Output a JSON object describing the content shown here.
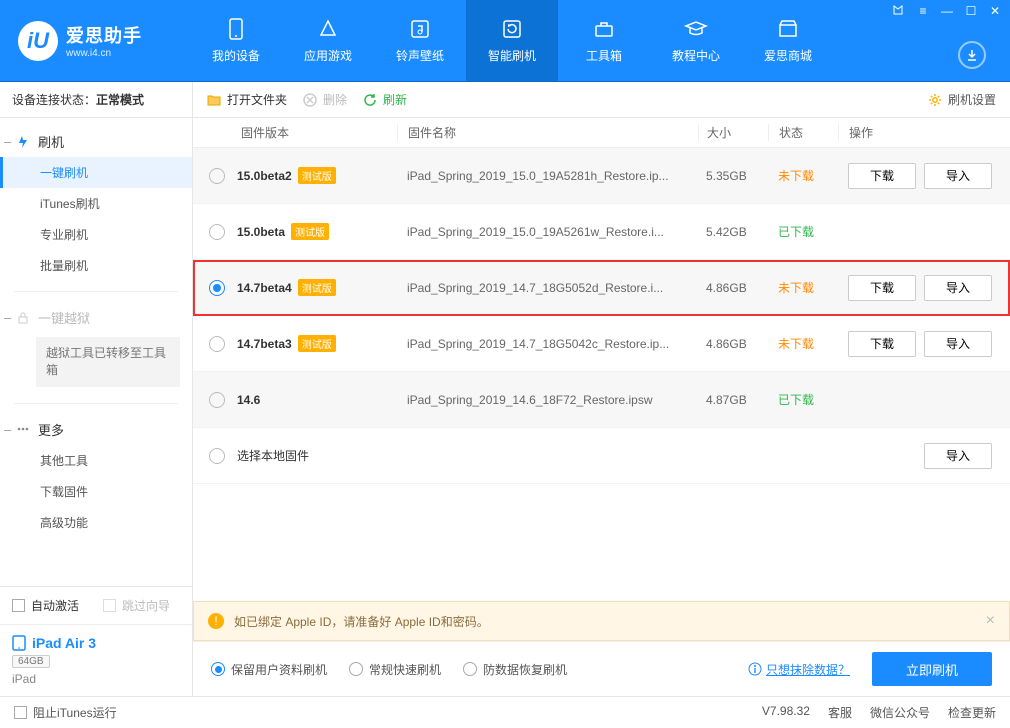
{
  "app": {
    "name_cn": "爱思助手",
    "url": "www.i4.cn"
  },
  "window_controls": {
    "shirt": "▾",
    "menu": "≡",
    "min": "—",
    "max": "☐",
    "close": "✕"
  },
  "nav": [
    {
      "label": "我的设备"
    },
    {
      "label": "应用游戏"
    },
    {
      "label": "铃声壁纸"
    },
    {
      "label": "智能刷机"
    },
    {
      "label": "工具箱"
    },
    {
      "label": "教程中心"
    },
    {
      "label": "爱思商城"
    }
  ],
  "sidebar": {
    "conn_label": "设备连接状态：",
    "conn_value": "正常模式",
    "groups": {
      "flash": {
        "title": "刷机",
        "items": [
          "一键刷机",
          "iTunes刷机",
          "专业刷机",
          "批量刷机"
        ]
      },
      "jailbreak": {
        "title": "一键越狱",
        "note": "越狱工具已转移至工具箱"
      },
      "more": {
        "title": "更多",
        "items": [
          "其他工具",
          "下载固件",
          "高级功能"
        ]
      }
    },
    "auto_activate": "自动激活",
    "skip_guide": "跳过向导",
    "device": {
      "name": "iPad Air 3",
      "storage": "64GB",
      "type": "iPad"
    }
  },
  "toolbar": {
    "open": "打开文件夹",
    "delete": "删除",
    "refresh": "刷新",
    "settings": "刷机设置"
  },
  "table": {
    "headers": {
      "version": "固件版本",
      "name": "固件名称",
      "size": "大小",
      "status": "状态",
      "ops": "操作"
    },
    "beta_tag": "测试版",
    "btn_download": "下载",
    "btn_import": "导入",
    "local_label": "选择本地固件",
    "rows": [
      {
        "version": "15.0beta2",
        "beta": true,
        "name": "iPad_Spring_2019_15.0_19A5281h_Restore.ip...",
        "size": "5.35GB",
        "status": "未下载",
        "downloaded": false,
        "selected": false,
        "show_dl": true
      },
      {
        "version": "15.0beta",
        "beta": true,
        "name": "iPad_Spring_2019_15.0_19A5261w_Restore.i...",
        "size": "5.42GB",
        "status": "已下载",
        "downloaded": true,
        "selected": false,
        "show_dl": false
      },
      {
        "version": "14.7beta4",
        "beta": true,
        "name": "iPad_Spring_2019_14.7_18G5052d_Restore.i...",
        "size": "4.86GB",
        "status": "未下载",
        "downloaded": false,
        "selected": true,
        "show_dl": true
      },
      {
        "version": "14.7beta3",
        "beta": true,
        "name": "iPad_Spring_2019_14.7_18G5042c_Restore.ip...",
        "size": "4.86GB",
        "status": "未下载",
        "downloaded": false,
        "selected": false,
        "show_dl": true
      },
      {
        "version": "14.6",
        "beta": false,
        "name": "iPad_Spring_2019_14.6_18F72_Restore.ipsw",
        "size": "4.87GB",
        "status": "已下载",
        "downloaded": true,
        "selected": false,
        "show_dl": false
      }
    ]
  },
  "notice": "如已绑定 Apple ID，请准备好 Apple ID和密码。",
  "actions": {
    "opts": [
      "保留用户资料刷机",
      "常规快速刷机",
      "防数据恢复刷机"
    ],
    "erase_link": "只想抹除数据？",
    "flash_now": "立即刷机"
  },
  "footer": {
    "block_itunes": "阻止iTunes运行",
    "version": "V7.98.32",
    "service": "客服",
    "wechat": "微信公众号",
    "update": "检查更新"
  }
}
